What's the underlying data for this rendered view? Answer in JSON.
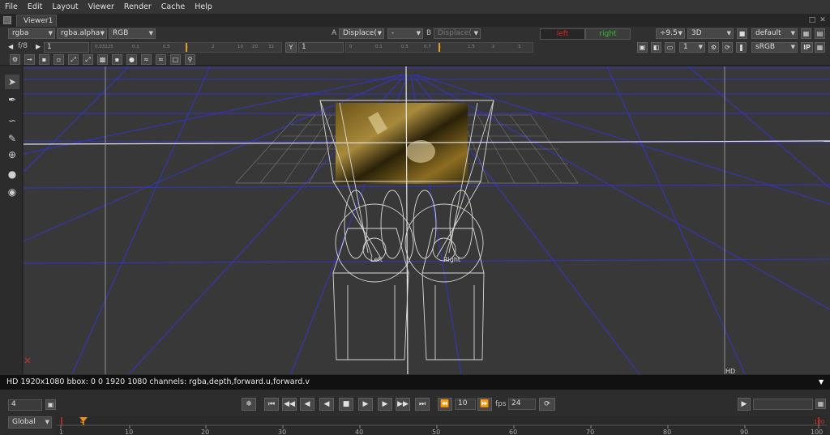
{
  "menu": [
    "File",
    "Edit",
    "Layout",
    "Viewer",
    "Render",
    "Cache",
    "Help"
  ],
  "tab": {
    "title": "Viewer1"
  },
  "toolbar1": {
    "channels": "rgba",
    "alpha": "rgba.alpha",
    "colorspace": "RGB",
    "a_label": "A",
    "a_input": "Displace(",
    "op": "-",
    "b_label": "B",
    "b_input": "Displace(",
    "left_btn": "left",
    "right_btn": "right",
    "gain": "÷9.5",
    "view_mode": "3D",
    "lut": "default"
  },
  "toolbar2": {
    "fstop": "f/8",
    "gain_value": "1",
    "ruler_ticks": [
      "0.03125",
      "0.1",
      "0.5",
      "1",
      "2",
      "10",
      "20",
      "32"
    ],
    "y_label": "Y",
    "gamma_value": "1",
    "gamma_ticks": [
      "0",
      "0.1",
      "0.5",
      "0.7",
      "1",
      "1.5",
      "2",
      "3"
    ],
    "proxy": "1",
    "viewer_lut": "sRGB",
    "ip": "IP"
  },
  "overlay": {
    "left_label": "Left",
    "right_label": "Right",
    "hd_label": "HD"
  },
  "info": "HD 1920x1080 bbox: 0 0 1920 1080 channels: rgba,depth,forward.u,forward.v",
  "playback": {
    "frame": "4",
    "increment": "10",
    "fps_label": "fps",
    "fps": "24",
    "scope": "Global",
    "ticks": [
      "1",
      "10",
      "20",
      "30",
      "40",
      "50",
      "60",
      "70",
      "80",
      "90",
      "100"
    ],
    "end_frame": "100",
    "marker_frame": "4"
  },
  "colors": {
    "left": "#e02020",
    "right": "#30c030",
    "grid": "#3a3ae0",
    "wire": "#d8d8d8"
  }
}
